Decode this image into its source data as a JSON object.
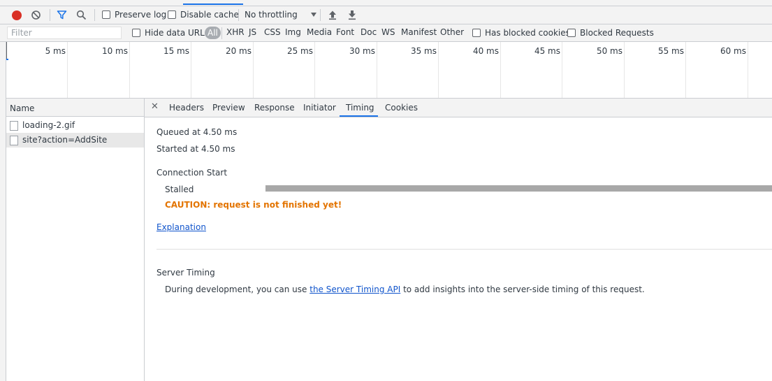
{
  "toolbar": {
    "record_icon": "record-icon",
    "clear_icon": "clear-icon",
    "filter_icon": "filter-icon",
    "search_icon": "search-icon",
    "preserve_log": "Preserve log",
    "disable_cache": "Disable cache",
    "throttling": "No throttling",
    "import_icon": "import-har-icon",
    "export_icon": "export-har-icon"
  },
  "filterbar": {
    "filter_placeholder": "Filter",
    "hide_data_urls": "Hide data URLs",
    "types": [
      "All",
      "XHR",
      "JS",
      "CSS",
      "Img",
      "Media",
      "Font",
      "Doc",
      "WS",
      "Manifest",
      "Other"
    ],
    "has_blocked_cookies": "Has blocked cookies",
    "blocked_requests": "Blocked Requests"
  },
  "overview": {
    "ticks": [
      "5 ms",
      "10 ms",
      "15 ms",
      "20 ms",
      "25 ms",
      "30 ms",
      "35 ms",
      "40 ms",
      "45 ms",
      "50 ms",
      "55 ms",
      "60 ms"
    ]
  },
  "requests": {
    "header": "Name",
    "items": [
      {
        "name": "loading-2.gif",
        "selected": false
      },
      {
        "name": "site?action=AddSite",
        "selected": true
      }
    ]
  },
  "details": {
    "close_icon": "close-icon",
    "tabs": [
      "Headers",
      "Preview",
      "Response",
      "Initiator",
      "Timing",
      "Cookies"
    ],
    "active_tab": "Timing"
  },
  "timing": {
    "queued": "Queued at 4.50 ms",
    "started": "Started at 4.50 ms",
    "connection_start": "Connection Start",
    "stalled": "Stalled",
    "caution": "CAUTION: request is not finished yet!",
    "explanation": "Explanation",
    "server_timing": "Server Timing",
    "server_timing_pre": "During development, you can use ",
    "server_timing_link": "the Server Timing API",
    "server_timing_post": " to add insights into the server-side timing of this request."
  },
  "colors": {
    "record": "#d93025",
    "accent": "#1a73e8",
    "caution": "#e37400",
    "link": "#1155cc",
    "bar": "#a8a8a8"
  }
}
